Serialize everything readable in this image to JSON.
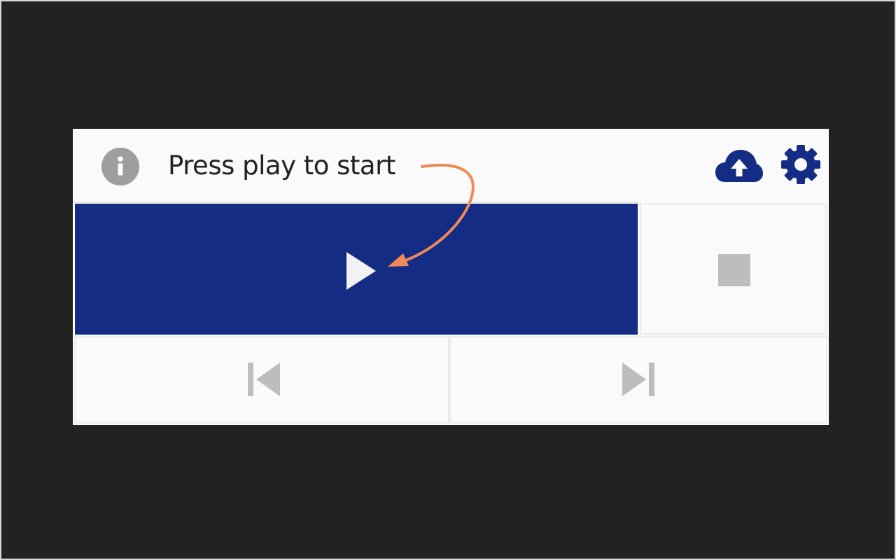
{
  "header": {
    "status_text": "Press play to start",
    "info_icon": "info-icon",
    "upload_icon": "cloud-upload-icon",
    "settings_icon": "gear-icon"
  },
  "controls": {
    "play_icon": "play-icon",
    "stop_icon": "stop-icon",
    "previous_icon": "skip-previous-icon",
    "next_icon": "skip-next-icon"
  },
  "annotation": {
    "arrow_icon": "annotation-arrow-icon"
  },
  "colors": {
    "accent": "#142c84",
    "frame": "#222222",
    "panel": "#fafafa",
    "inactive_icon": "#bdbdbd",
    "info_icon": "#9e9e9e",
    "annotation": "#ef8a56"
  }
}
